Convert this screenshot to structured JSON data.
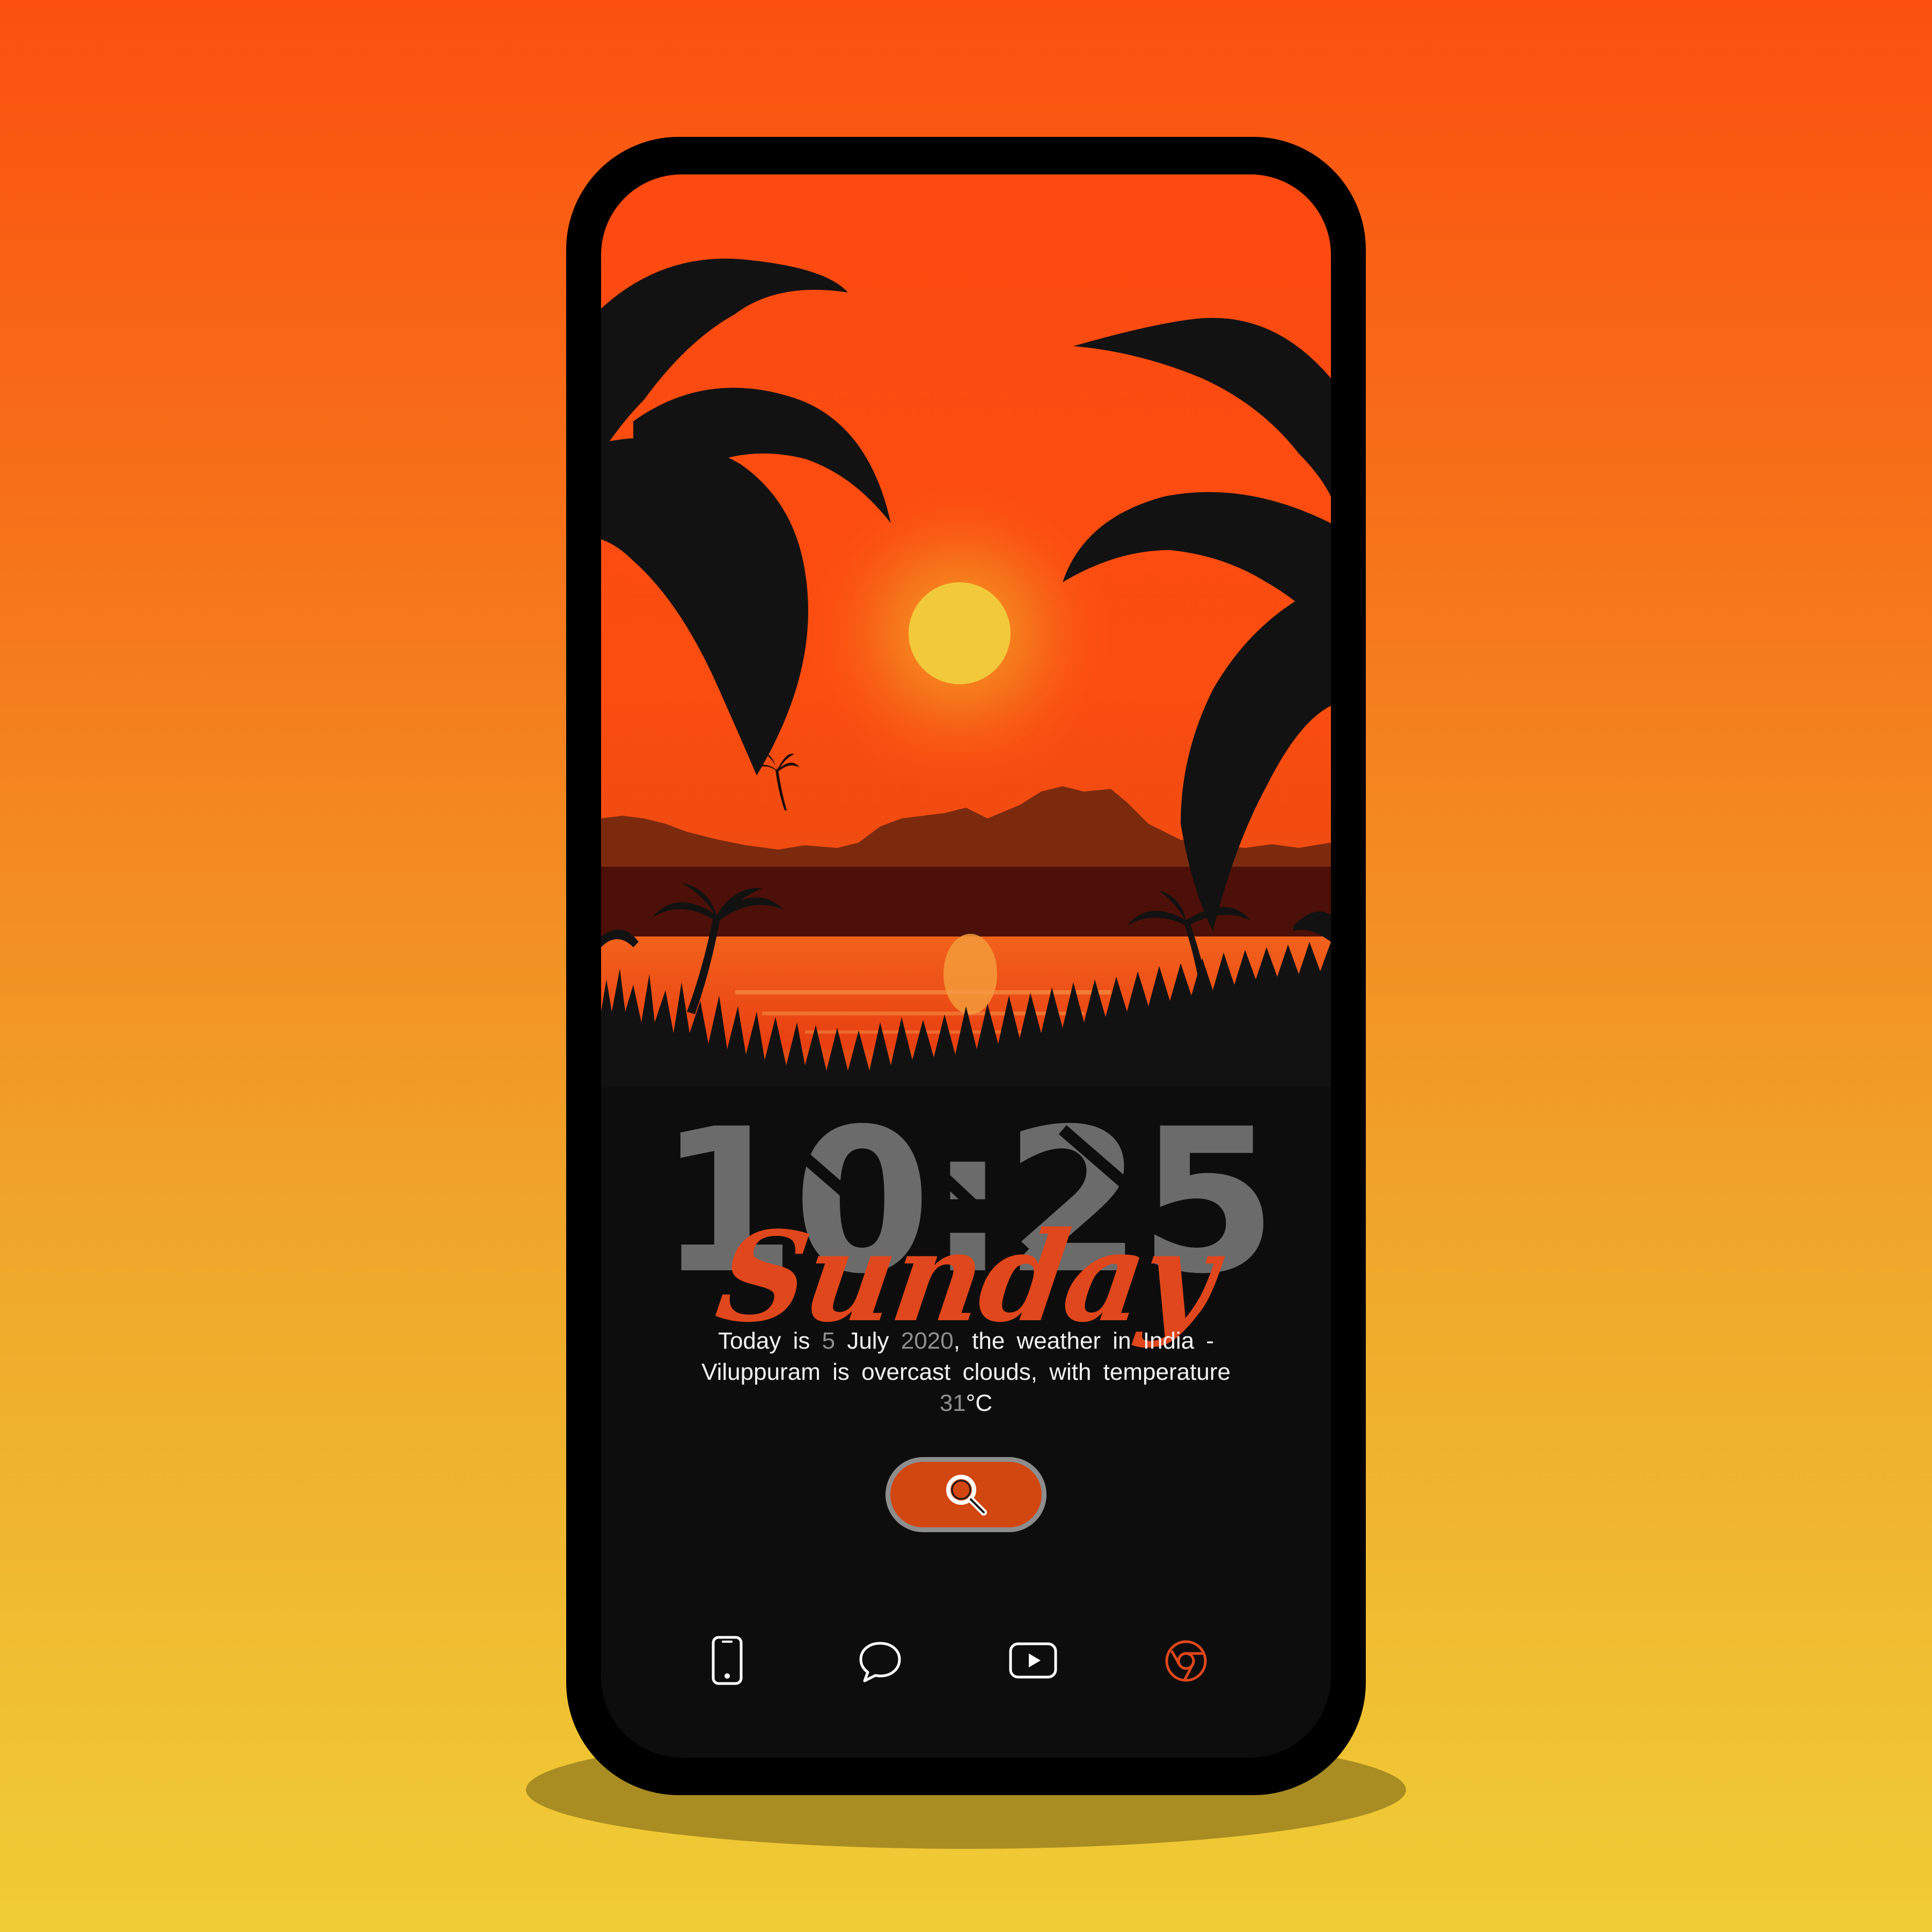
{
  "lockscreen": {
    "time": "10:25",
    "day": "Sunday",
    "weather": {
      "prefix": "Today is",
      "day_num": "5",
      "month": "July",
      "year": "2020",
      "middle": ", the weather in India -",
      "line2": "Viluppuram is overcast clouds, with temperature",
      "temperature": "31",
      "unit": "°C"
    }
  },
  "search": {
    "icon": "search-icon"
  },
  "dock": {
    "items": [
      {
        "name": "phone",
        "icon": "phone-icon"
      },
      {
        "name": "messages",
        "icon": "chat-bubble-icon"
      },
      {
        "name": "youtube",
        "icon": "play-icon"
      },
      {
        "name": "chrome",
        "icon": "chrome-icon"
      }
    ]
  },
  "colors": {
    "background_top": "#fb500f",
    "background_bottom": "#f0cd36",
    "phone_body": "#000000",
    "screen_bg": "#0d0d0d",
    "accent": "#e0471c",
    "clock": "#6b6b6b",
    "sun": "#f2c93a"
  }
}
